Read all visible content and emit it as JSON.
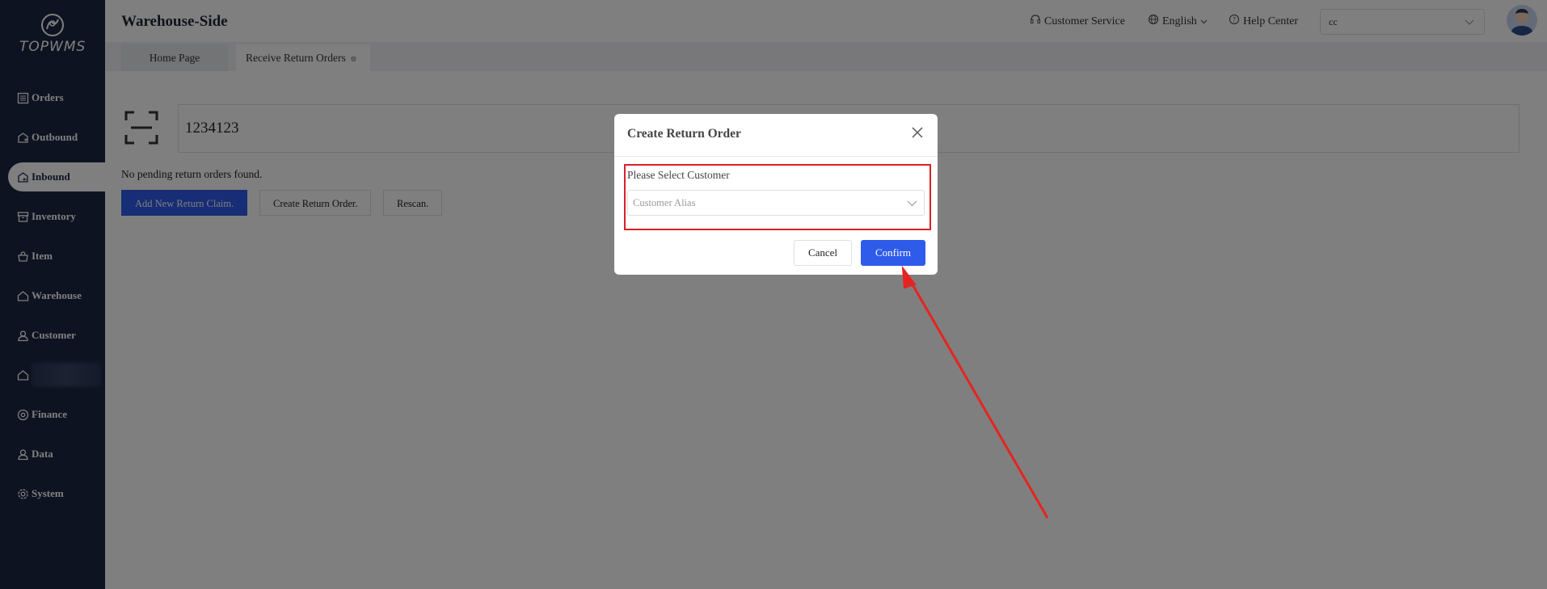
{
  "sidebar": {
    "logo_text": "TOPWMS",
    "items": [
      {
        "label": "Orders",
        "icon": "document-list-icon"
      },
      {
        "label": "Outbound",
        "icon": "box-out-icon"
      },
      {
        "label": "Inbound",
        "icon": "box-in-icon"
      },
      {
        "label": "Inventory",
        "icon": "archive-icon"
      },
      {
        "label": "Item",
        "icon": "basket-icon"
      },
      {
        "label": "Warehouse",
        "icon": "house-icon"
      },
      {
        "label": "Customer",
        "icon": "user-icon"
      },
      {
        "label": "",
        "icon": "house-icon"
      },
      {
        "label": "Finance",
        "icon": "finance-icon"
      },
      {
        "label": "Data",
        "icon": "user-data-icon"
      },
      {
        "label": "System",
        "icon": "gear-icon"
      }
    ],
    "active_index": 2
  },
  "header": {
    "title": "Warehouse-Side",
    "customer_service": "Customer Service",
    "language": "English",
    "help_center": "Help Center",
    "customer_select_value": "cc"
  },
  "tabs": {
    "home": "Home Page",
    "active": "Receive Return Orders"
  },
  "content": {
    "scan_value": "1234123",
    "message": "No pending return orders found.",
    "buttons": {
      "add_claim": "Add New Return Claim.",
      "create_order": "Create Return Order.",
      "rescan": "Rescan."
    }
  },
  "modal": {
    "title": "Create Return Order",
    "field_label": "Please Select Customer",
    "select_placeholder": "Customer Alias",
    "cancel": "Cancel",
    "confirm": "Confirm"
  },
  "colors": {
    "sidebar_bg": "#1b2642",
    "primary": "#2f5bea",
    "annotation_red": "#d9202a"
  }
}
